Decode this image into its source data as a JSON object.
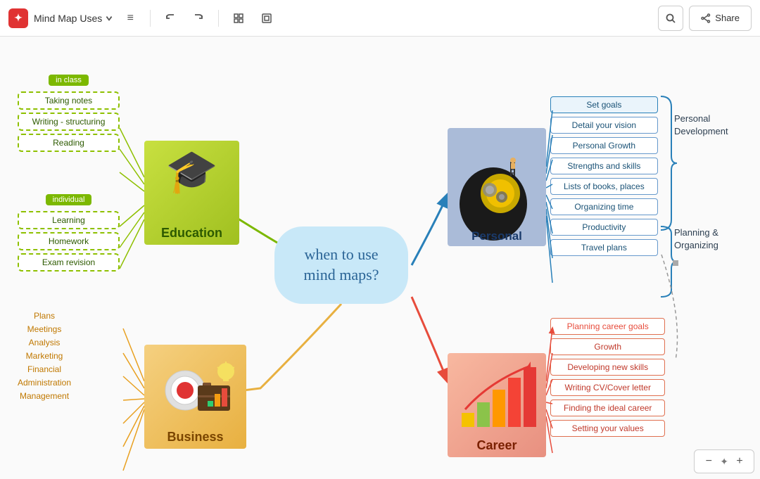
{
  "topbar": {
    "logo": "✦",
    "title": "Mind Map Uses",
    "hamburger": "≡",
    "undo": "↩",
    "redo": "↪",
    "share_label": "Share",
    "search_icon": "🔍"
  },
  "center_node": {
    "text": "when to use\nmind maps?"
  },
  "education": {
    "label": "Education",
    "in_class_badge": "in class",
    "in_class_items": [
      "Taking notes",
      "Writing - structuring",
      "Reading"
    ],
    "individual_badge": "individual",
    "individual_items": [
      "Learning",
      "Homework",
      "Exam revision"
    ]
  },
  "business": {
    "label": "Business",
    "header": "Plans",
    "items": [
      "Meetings",
      "Analysis",
      "Marketing",
      "Financial",
      "Administration",
      "Management"
    ]
  },
  "personal": {
    "label": "Personal",
    "items": [
      "Set goals",
      "Detail your vision",
      "Personal Growth",
      "Strengths and skills",
      "Lists of books, places",
      "Organizing time",
      "Productivity",
      "Travel plans"
    ]
  },
  "career": {
    "label": "Career",
    "items": [
      "Planning career goals",
      "Growth",
      "Developing new skills",
      "Writing CV/Cover letter",
      "Finding the ideal career",
      "Setting  your values"
    ]
  },
  "labels": {
    "personal_development_line1": "Personal",
    "personal_development_line2": "Development",
    "planning_line1": "Planning &",
    "planning_line2": "Organizing"
  },
  "zoom": {
    "minus": "−",
    "plus": "+"
  }
}
